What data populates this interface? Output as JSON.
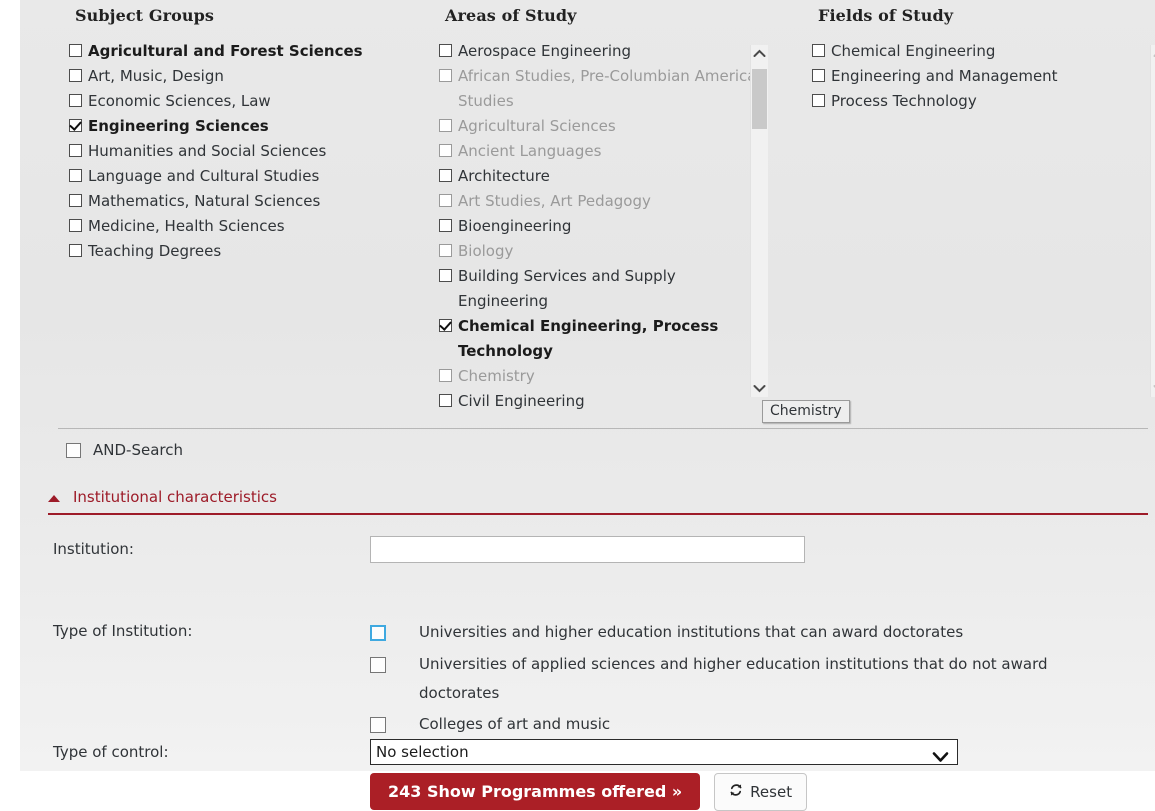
{
  "columns": [
    {
      "title": "Subject Groups",
      "scrollbar": false,
      "items": [
        {
          "label": "Agricultural and Forest Sciences",
          "checked": false,
          "disabled": false
        },
        {
          "label": "Art, Music, Design",
          "checked": false,
          "disabled": false
        },
        {
          "label": "Economic Sciences, Law",
          "checked": false,
          "disabled": false
        },
        {
          "label": "Engineering Sciences",
          "checked": true,
          "disabled": false
        },
        {
          "label": "Humanities and Social Sciences",
          "checked": false,
          "disabled": false
        },
        {
          "label": "Language and Cultural Studies",
          "checked": false,
          "disabled": false
        },
        {
          "label": "Mathematics, Natural Sciences",
          "checked": false,
          "disabled": false
        },
        {
          "label": "Medicine, Health Sciences",
          "checked": false,
          "disabled": false
        },
        {
          "label": "Teaching Degrees",
          "checked": false,
          "disabled": false
        }
      ]
    },
    {
      "title": "Areas of Study",
      "scrollbar": true,
      "scrollbar_enabled": true,
      "items": [
        {
          "label": "Aerospace Engineering",
          "checked": false,
          "disabled": false
        },
        {
          "label": "African Studies, Pre-Columbian American Studies",
          "checked": false,
          "disabled": true
        },
        {
          "label": "Agricultural Sciences",
          "checked": false,
          "disabled": true
        },
        {
          "label": "Ancient Languages",
          "checked": false,
          "disabled": true
        },
        {
          "label": "Architecture",
          "checked": false,
          "disabled": false
        },
        {
          "label": "Art Studies, Art Pedagogy",
          "checked": false,
          "disabled": true
        },
        {
          "label": "Bioengineering",
          "checked": false,
          "disabled": false
        },
        {
          "label": "Biology",
          "checked": false,
          "disabled": true
        },
        {
          "label": "Building Services and Supply Engineering",
          "checked": false,
          "disabled": false
        },
        {
          "label": "Chemical Engineering, Process Technology",
          "checked": true,
          "disabled": false
        },
        {
          "label": "Chemistry",
          "checked": false,
          "disabled": true
        },
        {
          "label": "Civil Engineering",
          "checked": false,
          "disabled": false
        }
      ]
    },
    {
      "title": "Fields of Study",
      "scrollbar": true,
      "scrollbar_enabled": false,
      "items": [
        {
          "label": "Chemical Engineering",
          "checked": false,
          "disabled": false
        },
        {
          "label": "Engineering and Management",
          "checked": false,
          "disabled": false
        },
        {
          "label": "Process Technology",
          "checked": false,
          "disabled": false
        }
      ]
    }
  ],
  "tooltip": {
    "text": "Chemistry"
  },
  "and_search": {
    "label": "AND-Search",
    "checked": false
  },
  "section": {
    "title": "Institutional characteristics",
    "expanded": true,
    "accent_color": "#9d1b28"
  },
  "form": {
    "institution": {
      "label": "Institution:",
      "value": "",
      "placeholder": ""
    },
    "type_of_institution": {
      "label": "Type of Institution:",
      "options": [
        {
          "text": "Universities and higher education institutions that can award doctorates",
          "checked": false,
          "focused": true
        },
        {
          "text": "Universities of applied sciences and higher education institutions that do not award doctorates",
          "checked": false,
          "focused": false
        },
        {
          "text": "Colleges of art and music",
          "checked": false,
          "focused": false
        }
      ]
    },
    "type_of_control": {
      "label": "Type of control:",
      "selected": "No selection"
    }
  },
  "buttons": {
    "submit": "243 Show Programmes offered »",
    "reset": "Reset"
  }
}
